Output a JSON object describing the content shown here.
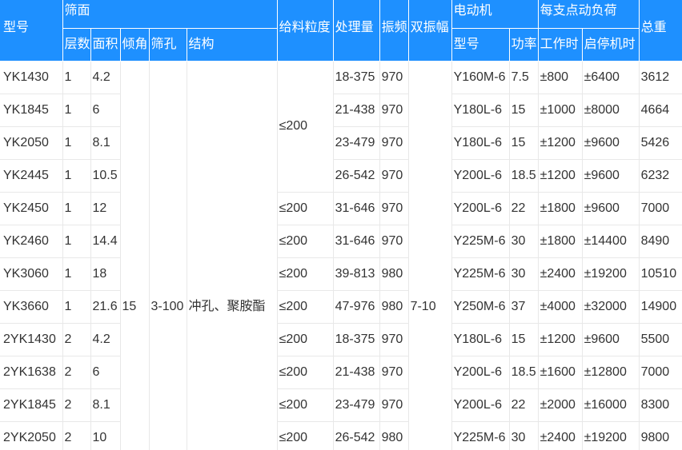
{
  "table": {
    "header": {
      "model": "型号",
      "screen_surface": "筛面",
      "layers": "层数",
      "area": "面积",
      "inclination": "倾角",
      "aperture": "筛孔",
      "structure": "结构",
      "feed_size": "给料粒度",
      "capacity": "处理量",
      "frequency": "振频",
      "double_amplitude": "双振幅",
      "motor": "电动机",
      "motor_model": "型号",
      "motor_power": "功率",
      "support_load": "每支点动负荷",
      "load_working": "工作时",
      "load_start_stop": "启停机时",
      "total_weight": "总重"
    },
    "shared_values": {
      "inclination": "15",
      "aperture": "3-100",
      "structure": "冲孔、聚胺酯",
      "double_amplitude": "7-10",
      "feed_size_group": "≤200"
    },
    "rows": [
      {
        "model": "YK1430",
        "layers": "1",
        "area": "4.2",
        "capacity": "18-375",
        "frequency": "970",
        "motor_model": "Y160M-6",
        "motor_power": "7.5",
        "load_working": "±800",
        "load_start_stop": "±6400",
        "total_weight": "3612"
      },
      {
        "model": "YK1845",
        "layers": "1",
        "area": "6",
        "capacity": "21-438",
        "frequency": "970",
        "motor_model": "Y180L-6",
        "motor_power": "15",
        "load_working": "±1000",
        "load_start_stop": "±8000",
        "total_weight": "4664"
      },
      {
        "model": "YK2050",
        "layers": "1",
        "area": "8.1",
        "capacity": "23-479",
        "frequency": "970",
        "motor_model": "Y180L-6",
        "motor_power": "15",
        "load_working": "±1200",
        "load_start_stop": "±9600",
        "total_weight": "5426"
      },
      {
        "model": "YK2445",
        "layers": "1",
        "area": "10.5",
        "capacity": "26-542",
        "frequency": "970",
        "motor_model": "Y200L-6",
        "motor_power": "18.5",
        "load_working": "±1200",
        "load_start_stop": "±9600",
        "total_weight": "6232"
      },
      {
        "model": "YK2450",
        "layers": "1",
        "area": "12",
        "feed_size": "≤200",
        "capacity": "31-646",
        "frequency": "970",
        "motor_model": "Y200L-6",
        "motor_power": "22",
        "load_working": "±1800",
        "load_start_stop": "±9600",
        "total_weight": "7000"
      },
      {
        "model": "YK2460",
        "layers": "1",
        "area": "14.4",
        "feed_size": "≤200",
        "capacity": "31-646",
        "frequency": "970",
        "motor_model": "Y225M-6",
        "motor_power": "30",
        "load_working": "±1800",
        "load_start_stop": "±14400",
        "total_weight": "8490"
      },
      {
        "model": "YK3060",
        "layers": "1",
        "area": "18",
        "feed_size": "≤200",
        "capacity": "39-813",
        "frequency": "980",
        "motor_model": "Y225M-6",
        "motor_power": "30",
        "load_working": "±2400",
        "load_start_stop": "±19200",
        "total_weight": "10510"
      },
      {
        "model": "YK3660",
        "layers": "1",
        "area": "21.6",
        "feed_size": "≤200",
        "capacity": "47-976",
        "frequency": "980",
        "motor_model": "Y250M-6",
        "motor_power": "37",
        "load_working": "±4000",
        "load_start_stop": "±32000",
        "total_weight": "14900"
      },
      {
        "model": "2YK1430",
        "layers": "2",
        "area": "4.2",
        "feed_size": "≤200",
        "capacity": "18-375",
        "frequency": "970",
        "motor_model": "Y180L-6",
        "motor_power": "15",
        "load_working": "±1200",
        "load_start_stop": "±9600",
        "total_weight": "5500"
      },
      {
        "model": "2YK1638",
        "layers": "2",
        "area": "6",
        "feed_size": "≤200",
        "capacity": "21-438",
        "frequency": "970",
        "motor_model": "Y200L-6",
        "motor_power": "18.5",
        "load_working": "±1600",
        "load_start_stop": "±12800",
        "total_weight": "7000"
      },
      {
        "model": "2YK1845",
        "layers": "2",
        "area": "8.1",
        "feed_size": "≤200",
        "capacity": "23-479",
        "frequency": "970",
        "motor_model": "Y200L-6",
        "motor_power": "22",
        "load_working": "±2000",
        "load_start_stop": "±16000",
        "total_weight": "8300"
      },
      {
        "model": "2YK2050",
        "layers": "2",
        "area": "10",
        "feed_size": "≤200",
        "capacity": "26-542",
        "frequency": "980",
        "motor_model": "Y225M-6",
        "motor_power": "30",
        "load_working": "±2400",
        "load_start_stop": "±19200",
        "total_weight": "9800"
      }
    ]
  },
  "colors": {
    "header_background": "#1e90ff",
    "header_text": "#ffffff",
    "body_text": "#333333",
    "grid_line": "#e8e8e8"
  }
}
